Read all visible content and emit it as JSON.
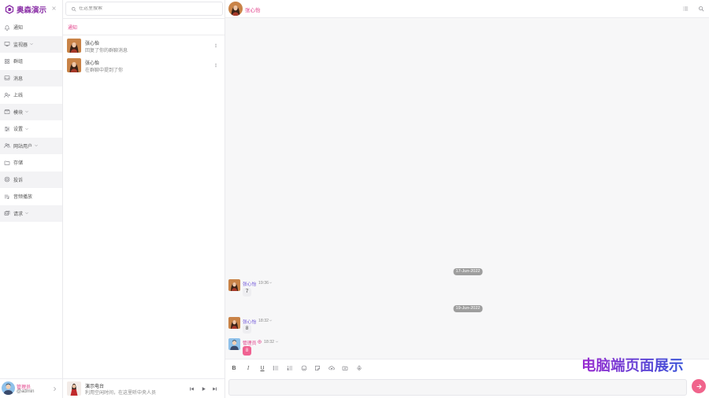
{
  "sidebar": {
    "brand": "奥森演示",
    "items": [
      {
        "label": "通知",
        "icon": "bell-icon"
      },
      {
        "label": "监视器",
        "icon": "monitor-icon",
        "expandable": true
      },
      {
        "label": "群组",
        "icon": "grid-icon"
      },
      {
        "label": "消息",
        "icon": "inbox-icon"
      },
      {
        "label": "上线",
        "icon": "user-lines-icon"
      },
      {
        "label": "模块",
        "icon": "package-icon",
        "expandable": true
      },
      {
        "label": "设置",
        "icon": "sliders-icon",
        "expandable": true
      },
      {
        "label": "网站用户",
        "icon": "users-icon",
        "expandable": true
      },
      {
        "label": "存储",
        "icon": "folder-icon"
      },
      {
        "label": "投诉",
        "icon": "target-circle-icon"
      },
      {
        "label": "音频播放",
        "icon": "playlist-icon"
      },
      {
        "label": "请求",
        "icon": "images-icon",
        "expandable": true
      }
    ],
    "profile": {
      "name": "管理员",
      "handle": "@admin"
    }
  },
  "middle": {
    "search": {
      "placeholder": "在这里搜索"
    },
    "section_title": "通知",
    "notifications": [
      {
        "name": "张心怡",
        "text": "回复了你的群聊消息"
      },
      {
        "name": "张心怡",
        "text": "在群聊中提到了你"
      }
    ],
    "player": {
      "title": "演示电台",
      "subtitle": "利用空闲时间，在这里听中央人员"
    }
  },
  "chat": {
    "contact_name": "张心怡",
    "timeline": [
      {
        "type": "date",
        "label": "17-Jun-2022"
      },
      {
        "type": "message",
        "sender": "张心怡",
        "time": "19:36",
        "text": "7"
      },
      {
        "type": "date",
        "label": "19-Jun-2022"
      },
      {
        "type": "message",
        "sender": "张心怡",
        "time": "18:32",
        "text": "8"
      },
      {
        "type": "message",
        "sender": "管理员",
        "time": "18:32",
        "text": "8",
        "own": true
      }
    ]
  },
  "composer": {
    "bold_label": "B",
    "italic_label": "I",
    "underline_label": "U",
    "tools": [
      "bold",
      "italic",
      "underline",
      "bullet-list-icon",
      "numbered-list-icon",
      "emoji-icon",
      "sticker-icon",
      "cloud-upload-icon",
      "folder-icon",
      "microphone-icon"
    ]
  },
  "overlay_caption": "电脑端页面展示",
  "colors": {
    "accent": "#e2418a",
    "brand": "#8a2fa6",
    "sender_name": "#6a4fd8",
    "date_pill": "#9e9e9e",
    "own_bubble": "#f06292",
    "send_button": "#f0648c",
    "caption_gradient": [
      "#9b2bd0",
      "#3b55d9"
    ]
  }
}
